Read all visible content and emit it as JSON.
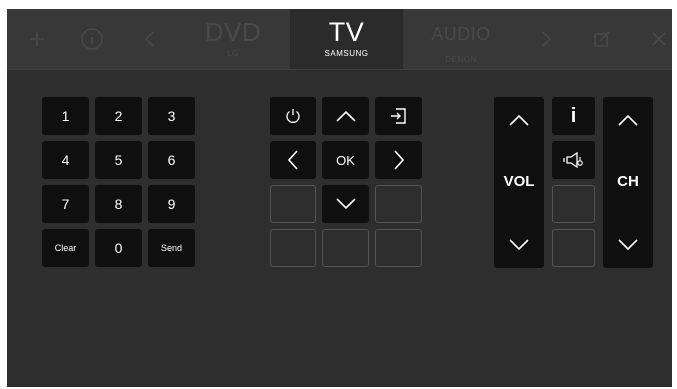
{
  "top_bar": {
    "icons": [
      "plus-icon",
      "info-icon",
      "chevron-left-icon",
      "chevron-right-icon",
      "edit-icon",
      "close-icon"
    ],
    "devices": [
      {
        "name": "DVD",
        "brand": "LG",
        "active": false
      },
      {
        "name": "TV",
        "brand": "SAMSUNG",
        "active": true
      },
      {
        "name": "AUDIO",
        "brand": "DENON",
        "active": false
      }
    ]
  },
  "keypad": {
    "keys": [
      "1",
      "2",
      "3",
      "4",
      "5",
      "6",
      "7",
      "8",
      "9",
      "Clear",
      "0",
      "Send"
    ]
  },
  "navigation": {
    "ok_label": "OK",
    "icons": [
      "power-icon",
      "arrow-up-icon",
      "input-source-icon",
      "arrow-left-icon",
      "arrow-right-icon",
      "arrow-down-icon"
    ]
  },
  "volume": {
    "label": "VOL"
  },
  "info_key": {
    "label": "i"
  },
  "channel": {
    "label": "CH"
  },
  "colors": {
    "panel": "#2e2e2e",
    "top_bar": "#383838",
    "key": "#0f0f0f",
    "empty_key_border": "#555555",
    "inactive_text": "#4a4a4a"
  }
}
